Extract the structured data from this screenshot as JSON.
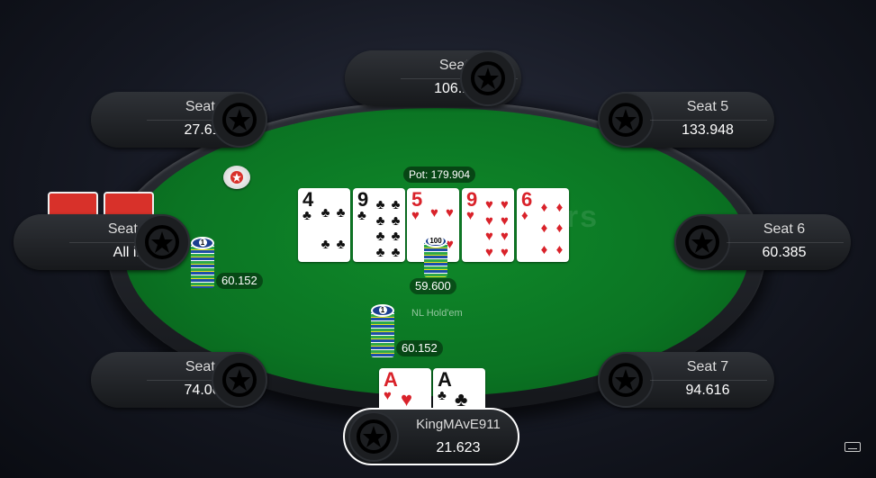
{
  "table": {
    "pot_label": "Pot: 179.904",
    "game_type": "NL Hold'em",
    "watermark": "ars"
  },
  "board": [
    {
      "rank": "4",
      "suit": "♣",
      "color": "black",
      "pips": [
        "♣",
        "♣",
        "♣",
        "♣"
      ]
    },
    {
      "rank": "9",
      "suit": "♣",
      "color": "black",
      "pips": [
        "♣",
        "♣",
        "♣",
        "♣",
        "♣",
        "♣",
        "♣",
        "♣"
      ]
    },
    {
      "rank": "5",
      "suit": "♥",
      "color": "red",
      "pips": [
        "♥",
        "♥",
        "♥",
        "♥"
      ]
    },
    {
      "rank": "9",
      "suit": "♥",
      "color": "red",
      "pips": [
        "♥",
        "♥",
        "♥",
        "♥",
        "♥",
        "♥",
        "♥",
        "♥"
      ]
    },
    {
      "rank": "6",
      "suit": "♦",
      "color": "red",
      "pips": [
        "♦",
        "♦",
        "♦",
        "♦",
        "♦",
        "♦"
      ]
    }
  ],
  "seats": [
    {
      "name": "Seat 1",
      "stack": "74.061"
    },
    {
      "name": "Seat 2",
      "stack": "All in"
    },
    {
      "name": "Seat 3",
      "stack": "27.610"
    },
    {
      "name": "Seat 4",
      "stack": "106.125"
    },
    {
      "name": "Seat 5",
      "stack": "133.948"
    },
    {
      "name": "Seat 6",
      "stack": "60.385"
    },
    {
      "name": "Seat 7",
      "stack": "94.616"
    }
  ],
  "hero": {
    "name": "KingMAvE911",
    "stack": "21.623",
    "cards": [
      {
        "rank": "A",
        "suit": "♥",
        "color": "red"
      },
      {
        "rank": "A",
        "suit": "♣",
        "color": "black"
      }
    ]
  },
  "bets": {
    "seat2": "60.152",
    "center": "59.600",
    "hero": "60.152"
  },
  "chips": {
    "seat2_top": "1",
    "center_top": "100",
    "hero_top": "1"
  },
  "colors": {
    "felt": "#0b7423",
    "red_suit": "#d9222a",
    "card_back": "#d8312a"
  }
}
